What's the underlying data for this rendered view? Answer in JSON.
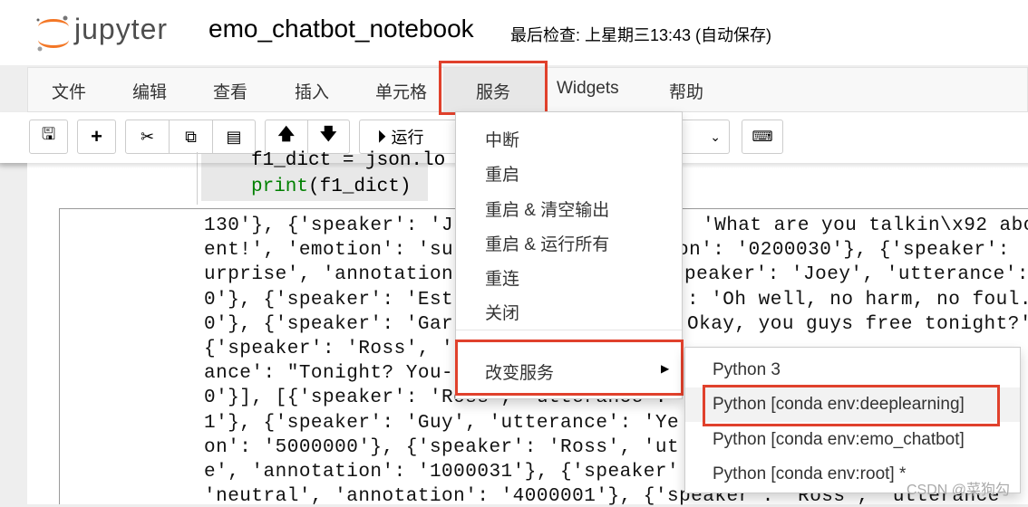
{
  "header": {
    "logo_text": "jupyter",
    "notebook_name": "emo_chatbot_notebook",
    "checkpoint": "最后检查: 上星期三13:43  (自动保存)"
  },
  "menubar": {
    "items": [
      "文件",
      "编辑",
      "查看",
      "插入",
      "单元格",
      "服务",
      "Widgets",
      "帮助"
    ],
    "active": "服务"
  },
  "toolbar": {
    "run_label": "运行"
  },
  "code": {
    "line1": "f1_dict = json.lo",
    "line2_fn": "print",
    "line2_rest": "(f1_dict)"
  },
  "output": {
    "lines": [
      {
        "left": "130'}, {'speaker': 'J",
        "right": "'What are you talkin\\x92 abo"
      },
      {
        "left": "ent!', 'emotion': 'su",
        "right": "on': '0200030'}, {'speaker': "
      },
      {
        "left": "urprise', 'annotation",
        "right": "peaker': 'Joey', 'utterance':"
      },
      {
        "left": "0'}, {'speaker': 'Est",
        "right": ": 'Oh well, no harm, no foul."
      },
      {
        "left": "0'}, {'speaker': 'Gar",
        "right": "Okay, you guys free tonight?'"
      },
      {
        "left": "{'speaker': 'Ross', '",
        "right": ""
      },
      {
        "left": "ance': \"Tonight? You-",
        "right": ""
      },
      {
        "left": "0'}], [{'speaker': 'Ross', 'utterance': ",
        "right": ""
      },
      {
        "left": "1'}, {'speaker': 'Guy', 'utterance': 'Ye",
        "right": ""
      },
      {
        "left": "on': '5000000'}, {'speaker': 'Ross', 'ut",
        "right": ""
      },
      {
        "left": "e', 'annotation': '1000031'}, {'speaker'",
        "right": ""
      },
      {
        "left": "'neutral', 'annotation': '4000001'}, {'speaker': 'Ross', 'utterance'",
        "right": ""
      }
    ]
  },
  "kernel_menu": {
    "items": [
      "中断",
      "重启",
      "重启 & 清空输出",
      "重启 & 运行所有",
      "重连",
      "关闭"
    ],
    "change_kernel": "改变服务"
  },
  "kernel_submenu": {
    "items": [
      "Python 3",
      "Python [conda env:deeplearning]",
      "Python [conda env:emo_chatbot]",
      "Python [conda env:root] *"
    ],
    "highlighted": "Python [conda env:deeplearning]"
  },
  "watermark": "CSDN @菜狗勾",
  "colors": {
    "highlight_box": "#e0412c",
    "menu_bg": "#f8f8f8",
    "code_keyword": "#008000"
  }
}
